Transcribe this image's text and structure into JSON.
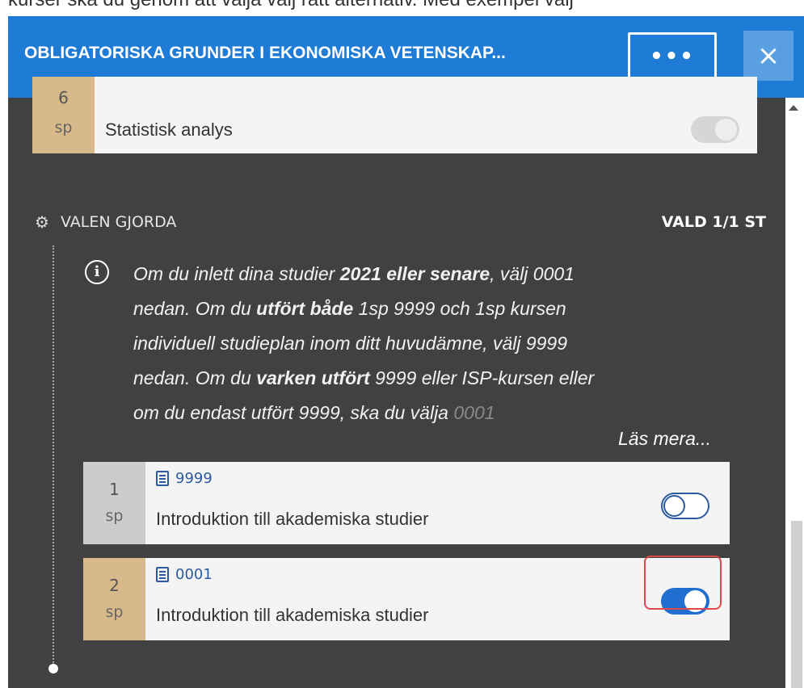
{
  "top_strip": {
    "text": "kurser ska du genom att välja välj rätt alternativ. Med exempel välj"
  },
  "header": {
    "title": "OBLIGATORISKA GRUNDER I EKONOMISKA VETENSKAP...",
    "more_label": "•••",
    "close_label": "×"
  },
  "previous_course": {
    "credits": "6",
    "unit": "sp",
    "name": "Statistisk analys",
    "toggle_state": "disabled"
  },
  "section": {
    "title": "VALEN GJORDA",
    "count": "VALD 1/1 ST",
    "info": {
      "line1_a": "Om du inlett dina studier ",
      "line1_b": "2021 eller senare",
      "line1_c": ", välj 0001",
      "line2_a": "nedan.  Om du ",
      "line2_b": "utfört både",
      "line2_c": " 1sp 9999 och 1sp kursen",
      "line3": "individuell studieplan inom ditt huvudämne, välj 9999",
      "line4_a": "nedan.  Om du ",
      "line4_b": "varken utfört",
      "line4_c": " 9999 eller ISP-kursen eller",
      "line5_a": "om du endast utfört 9999, ska du välja ",
      "line5_b": "0001",
      "read_more": "Läs mera..."
    }
  },
  "courses": [
    {
      "credits": "1",
      "unit": "sp",
      "code": "9999",
      "name": "Introduktion till akademiska studier",
      "selected": false
    },
    {
      "credits": "2",
      "unit": "sp",
      "code": "0001",
      "name": "Introduktion till akademiska studier",
      "selected": true
    }
  ],
  "colors": {
    "header_bg": "#1e7cd6",
    "panel_bg": "#414141",
    "credit_tan": "#d7b98c",
    "credit_grey": "#cccccc",
    "toggle_on": "#1f6ed0",
    "highlight": "#e04848"
  }
}
